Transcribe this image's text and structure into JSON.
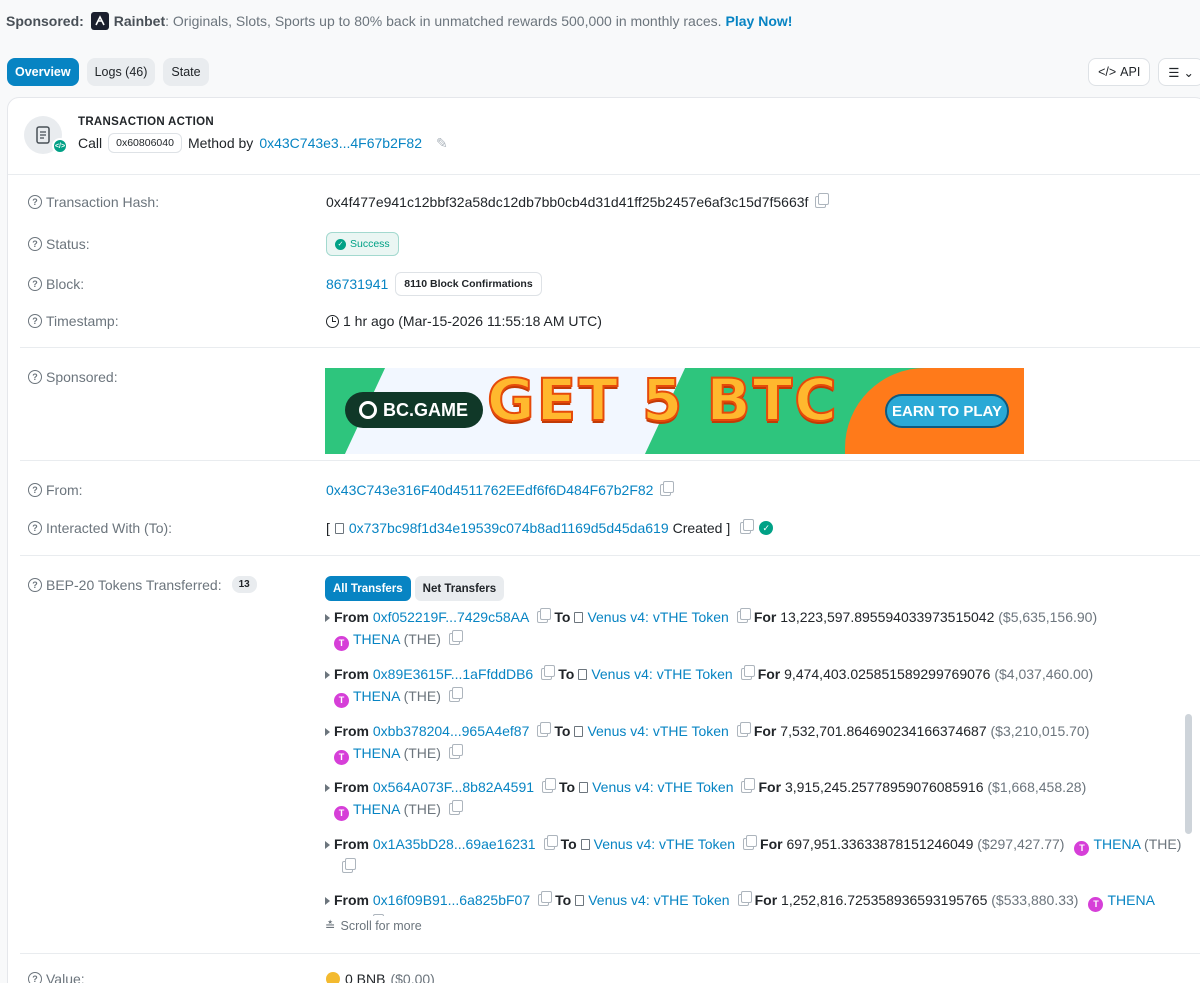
{
  "sponsor_bar": {
    "label": "Sponsored:",
    "brand": "Rainbet",
    "text": ": Originals, Slots, Sports up to 80% back in unmatched rewards 500,000 in monthly races.",
    "cta": "Play Now!"
  },
  "tabs": [
    {
      "label": "Overview",
      "active": true
    },
    {
      "label": "Logs (46)",
      "active": false
    },
    {
      "label": "State",
      "active": false
    }
  ],
  "tools": {
    "api_label": "API"
  },
  "transaction_action": {
    "title": "TRANSACTION ACTION",
    "call_label": "Call",
    "method_id": "0x60806040",
    "method_by_label": "Method by",
    "caller": "0x43C743e3...4F67b2F82"
  },
  "details": {
    "hash_label": "Transaction Hash:",
    "hash": "0x4f477e941c12bbf32a58dc12db7bb0cb4d31d41ff25b2457e6af3c15d7f5663f",
    "status_label": "Status:",
    "status": "Success",
    "block_label": "Block:",
    "block": "86731941",
    "confirmations": "8110 Block Confirmations",
    "timestamp_label": "Timestamp:",
    "timestamp": "1 hr ago (Mar-15-2026 11:55:18 AM UTC)",
    "sponsored_label": "Sponsored:",
    "from_label": "From:",
    "from": "0x43C743e316F40d4511762EEdf6f6D484F67b2F82",
    "to_label": "Interacted With (To):",
    "to_open": "[",
    "to": "0x737bc98f1d34e19539c074b8ad1169d5d45da619",
    "to_created": "Created ]",
    "tokens_label": "BEP-20 Tokens Transferred:",
    "tokens_count": "13",
    "value_label": "Value:",
    "value": "0 BNB",
    "value_usd": "($0.00)"
  },
  "banner": {
    "brand": "BC.GAME",
    "headline": "GET 5 BTC",
    "cta": "EARN TO PLAY"
  },
  "transfer_filters": {
    "all": "All Transfers",
    "net": "Net Transfers"
  },
  "transfer_words": {
    "from": "From",
    "to": "To",
    "for": "For"
  },
  "transfers": [
    {
      "from": "0xf052219F...7429c58AA",
      "to": "Venus v4: vTHE Token",
      "amount": "13,223,597.895594033973515042",
      "usd": "($5,635,156.90)",
      "token": "THENA",
      "symbol": "(THE)"
    },
    {
      "from": "0x89E3615F...1aFfddDB6",
      "to": "Venus v4: vTHE Token",
      "amount": "9,474,403.025851589299769076",
      "usd": "($4,037,460.00)",
      "token": "THENA",
      "symbol": "(THE)"
    },
    {
      "from": "0xbb378204...965A4ef87",
      "to": "Venus v4: vTHE Token",
      "amount": "7,532,701.864690234166374687",
      "usd": "($3,210,015.70)",
      "token": "THENA",
      "symbol": "(THE)"
    },
    {
      "from": "0x564A073F...8b82A4591",
      "to": "Venus v4: vTHE Token",
      "amount": "3,915,245.25778959076085916",
      "usd": "($1,668,458.28)",
      "token": "THENA",
      "symbol": "(THE)"
    },
    {
      "from": "0x1A35bD28...69ae16231",
      "to": "Venus v4: vTHE Token",
      "amount": "697,951.33633878151246049",
      "usd": "($297,427.77)",
      "token": "THENA",
      "symbol": "(THE)"
    },
    {
      "from": "0x16f09B91...6a825bF07",
      "to": "Venus v4: vTHE Token",
      "amount": "1,252,816.725358936593195765",
      "usd": "($533,880.33)",
      "token": "THENA",
      "symbol": "(THE)"
    }
  ],
  "scroll_more": "Scroll for more"
}
